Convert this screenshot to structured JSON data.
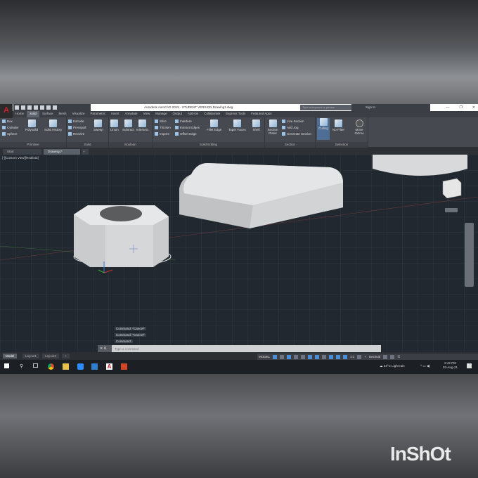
{
  "window": {
    "title": "Autodesk AutoCAD 2019 - STUDENT VERSION   Drawing1.dwg",
    "search_placeholder": "Type a keyword or phrase",
    "sign_in": "Sign In",
    "logo": "A"
  },
  "ribbon_tabs": [
    "Home",
    "Solid",
    "Surface",
    "Mesh",
    "Visualize",
    "Parametric",
    "Insert",
    "Annotate",
    "View",
    "Manage",
    "Output",
    "Add-ins",
    "Collaborate",
    "Express Tools",
    "Featured Apps"
  ],
  "active_tab": "Solid",
  "panels": {
    "primitive": {
      "label": "Primitive",
      "items": [
        "Box",
        "Cylinder",
        "Sphere"
      ],
      "polysolid": "Polysolid",
      "solid_history": "Solid History"
    },
    "solid": {
      "label": "Solid",
      "items": [
        "Extrude",
        "Presspull",
        "Revolve"
      ],
      "sweep": "Sweep"
    },
    "boolean": {
      "label": "Boolean",
      "items": [
        "Union",
        "Subtract",
        "Intersect"
      ]
    },
    "solid_editing": {
      "label": "Solid Editing",
      "items": [
        "Slice",
        "Thicken",
        "Imprint",
        "Interfere",
        "Extract Edges",
        "Offset Edge"
      ],
      "fillet": "Fillet Edge",
      "taper": "Taper Faces",
      "shell": "Shell"
    },
    "section": {
      "label": "Section",
      "plane": "Section Plane",
      "items": [
        "Live Section",
        "Add Jog",
        "Generate Section"
      ]
    },
    "selection": {
      "label": "Selection",
      "items": [
        "Culling",
        "No Filter",
        "Move Gizmo"
      ]
    }
  },
  "doc_tabs": [
    "Start",
    "Drawing1*"
  ],
  "viewport": {
    "label": "[-][Custom View][Realistic]"
  },
  "command": {
    "history": [
      "Command: *Cancel*",
      "Command: *Cancel*",
      "Command:"
    ],
    "placeholder": "Type a command"
  },
  "layout_tabs": [
    "Model",
    "Layout1",
    "Layout2"
  ],
  "status": {
    "mode": "MODEL",
    "units": "Decimal",
    "scale": "1:1"
  },
  "taskbar": {
    "weather": "34°C  Light rain",
    "time": "2:42 PM",
    "date": "03-Aug-21"
  },
  "watermark": "InShOt"
}
